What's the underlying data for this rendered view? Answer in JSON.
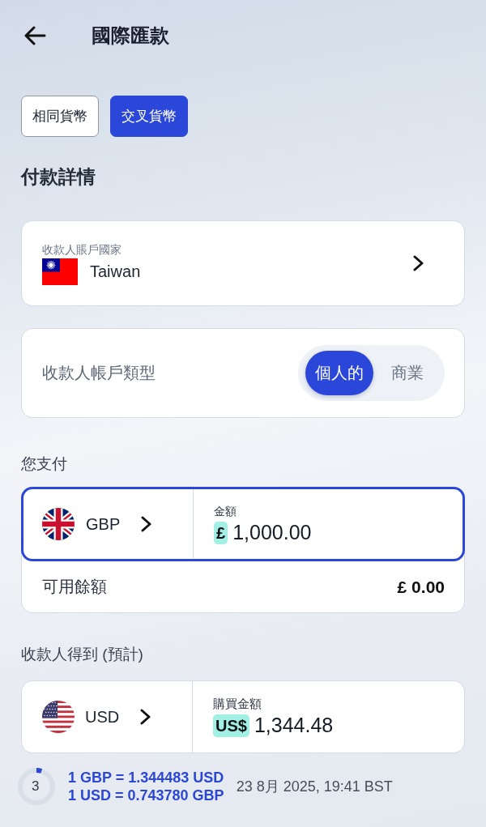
{
  "header": {
    "title": "國際匯款"
  },
  "transfer_tabs": [
    {
      "label": "相同貨幣",
      "selected": false
    },
    {
      "label": "交叉貨幣",
      "selected": true
    }
  ],
  "section_title": "付款詳情",
  "recipient_country": {
    "label": "收款人賬戶國家",
    "value": "Taiwan"
  },
  "account_type": {
    "label": "收款人帳戶類型",
    "options": [
      {
        "label": "個人的",
        "selected": true
      },
      {
        "label": "商業",
        "selected": false
      }
    ]
  },
  "you_pay": {
    "heading": "您支付",
    "currency": "GBP",
    "amount_label": "金額",
    "symbol": "£",
    "amount": "1,000.00",
    "focused": true,
    "balance_label": "可用餘額",
    "balance": "£ 0.00"
  },
  "recipient_gets": {
    "heading": "收款人得到 (預計)",
    "currency": "USD",
    "amount_label": "購買金額",
    "symbol": "US$",
    "amount": "1,344.48"
  },
  "rate": {
    "countdown": "3",
    "lines": [
      "1 GBP = 1.344483 USD",
      "1 USD = 0.743780 GBP"
    ],
    "timestamp": "23 8月 2025, 19:41 BST"
  }
}
